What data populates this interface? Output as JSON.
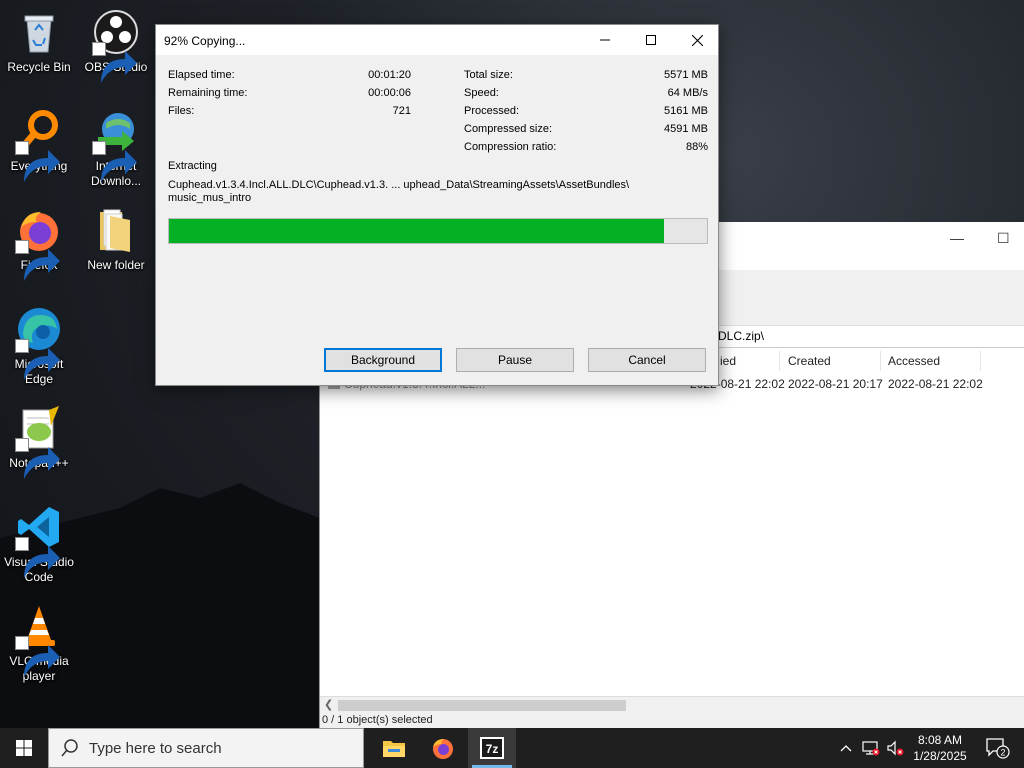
{
  "desktop": {
    "icons": [
      {
        "label": "Recycle Bin"
      },
      {
        "label": "OBS Studio"
      },
      {
        "label": "Everything"
      },
      {
        "label": "Internet Downlo..."
      },
      {
        "label": "Firefox"
      },
      {
        "label": "New folder"
      },
      {
        "label": "Microsoft Edge"
      },
      {
        "label": "Notepad++"
      },
      {
        "label": "Visual Studio Code"
      },
      {
        "label": "VLC media player"
      }
    ]
  },
  "file_manager": {
    "address_fragment": "DLC.zip\\",
    "columns": {
      "modified": "ied",
      "created": "Created",
      "accessed": "Accessed"
    },
    "row": {
      "name": "Cuphead.v1.3.4.Incl.ALL...",
      "modified": "2022-08-21 22:02",
      "created": "2022-08-21 20:17",
      "accessed": "2022-08-21 22:02"
    },
    "status": "0 / 1 object(s) selected"
  },
  "dialog": {
    "title": "92% Copying...",
    "left_stats": [
      {
        "label": "Elapsed time:",
        "value": "00:01:20"
      },
      {
        "label": "Remaining time:",
        "value": "00:00:06"
      },
      {
        "label": "Files:",
        "value": "721"
      }
    ],
    "right_stats": [
      {
        "label": "Total size:",
        "value": "5571 MB"
      },
      {
        "label": "Speed:",
        "value": "64 MB/s"
      },
      {
        "label": "Processed:",
        "value": "5161 MB"
      },
      {
        "label": "Compressed size:",
        "value": "4591 MB"
      },
      {
        "label": "Compression ratio:",
        "value": "88%"
      }
    ],
    "operation": "Extracting",
    "path_line1": "Cuphead.v1.3.4.Incl.ALL.DLC\\Cuphead.v1.3. ... uphead_Data\\StreamingAssets\\AssetBundles\\",
    "path_line2": "music_mus_intro",
    "progress_percent": 92,
    "buttons": {
      "background": "Background",
      "pause": "Pause",
      "cancel": "Cancel"
    },
    "progress_color": "#06b025"
  },
  "taskbar": {
    "search_placeholder": "Type here to search",
    "time": "8:08 AM",
    "date": "1/28/2025",
    "notification_count": "2"
  }
}
